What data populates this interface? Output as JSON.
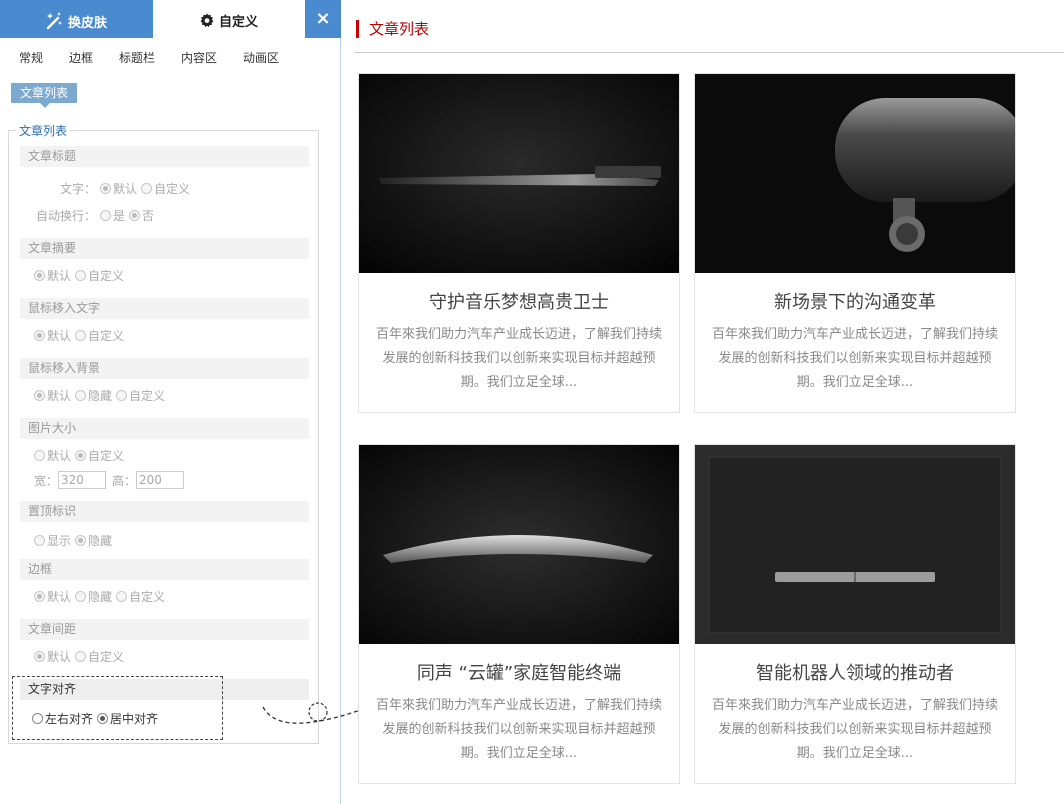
{
  "panel": {
    "tab_skin": "换皮肤",
    "tab_custom": "自定义",
    "close": "×",
    "subnav": [
      "常规",
      "边框",
      "标题栏",
      "内容区",
      "动画区"
    ],
    "crumb": "文章列表",
    "legend": "文章列表",
    "sections": {
      "title": {
        "label": "文章标题",
        "text_label": "文字：",
        "wrap_label": "自动换行：",
        "opt_default": "默认",
        "opt_custom": "自定义",
        "opt_yes": "是",
        "opt_no": "否"
      },
      "summary": {
        "label": "文章摘要",
        "opt_default": "默认",
        "opt_custom": "自定义"
      },
      "hover_text": {
        "label": "鼠标移入文字",
        "opt_default": "默认",
        "opt_custom": "自定义"
      },
      "hover_bg": {
        "label": "鼠标移入背景",
        "opt_default": "默认",
        "opt_hide": "隐藏",
        "opt_custom": "自定义"
      },
      "img_size": {
        "label": "图片大小",
        "opt_default": "默认",
        "opt_custom": "自定义",
        "width_label": "宽：",
        "width_value": "320",
        "height_label": "高：",
        "height_value": "200"
      },
      "top_mark": {
        "label": "置顶标识",
        "opt_show": "显示",
        "opt_hide": "隐藏"
      },
      "border": {
        "label": "边框",
        "opt_default": "默认",
        "opt_hide": "隐藏",
        "opt_custom": "自定义"
      },
      "spacing": {
        "label": "文章间距",
        "opt_default": "默认",
        "opt_custom": "自定义"
      },
      "align": {
        "label": "文字对齐",
        "opt_left": "左右对齐",
        "opt_center": "居中对齐"
      }
    }
  },
  "main": {
    "title": "文章列表",
    "cards": [
      {
        "title": "守护音乐梦想高贵卫士",
        "desc": "百年來我们助力汽车产业成长迈进，了解我们持续发展的创新科技我们以创新来实现目标并超越预期。我们立足全球..."
      },
      {
        "title": "新场景下的沟通变革",
        "desc": "百年來我们助力汽车产业成长迈进，了解我们持续发展的创新科技我们以创新来实现目标并超越预期。我们立足全球..."
      },
      {
        "title": "同声 “云罐”家庭智能终端",
        "desc": "百年來我们助力汽车产业成长迈进，了解我们持续发展的创新科技我们以创新来实现目标并超越预期。我们立足全球..."
      },
      {
        "title": "智能机器人领域的推动者",
        "desc": "百年來我们助力汽车产业成长迈进，了解我们持续发展的创新科技我们以创新来实现目标并超越预期。我们立足全球..."
      }
    ]
  },
  "colors": {
    "tab_blue": "#4a8bd0",
    "accent_red": "#c00000"
  }
}
